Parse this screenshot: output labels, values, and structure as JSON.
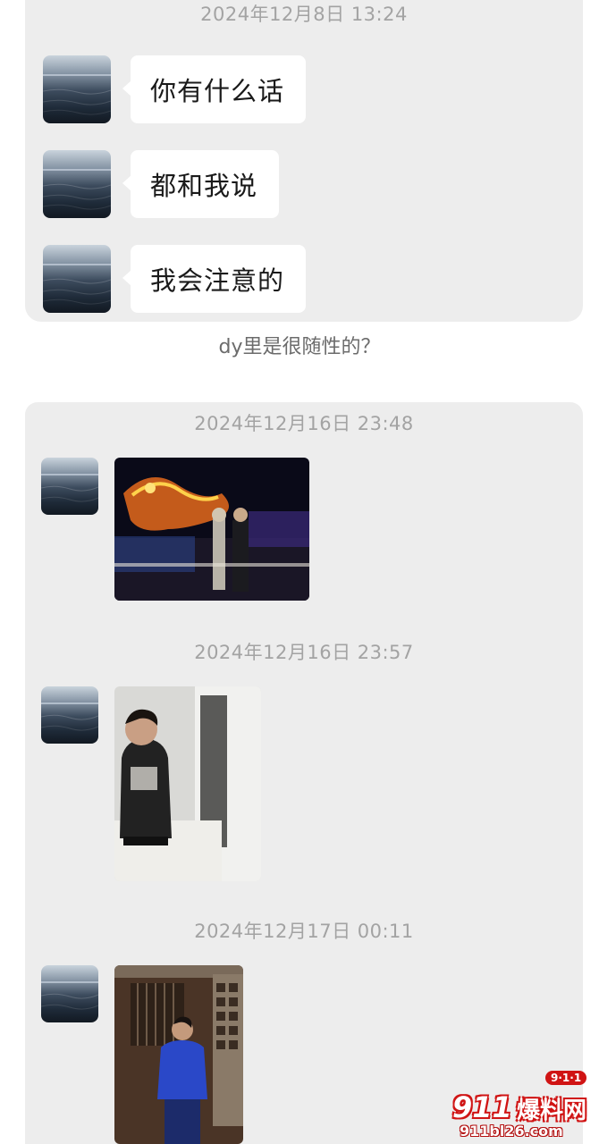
{
  "thread_top": {
    "timestamp": "2024年12月8日 13:24",
    "messages": [
      {
        "text": "你有什么话"
      },
      {
        "text": "都和我说"
      },
      {
        "text": "我会注意的"
      }
    ]
  },
  "caption": "dy里是很随性的？",
  "thread_bottom": {
    "groups": [
      {
        "timestamp": "2024年12月16日 23:48",
        "image": "night-dragon-lantern-photo"
      },
      {
        "timestamp": "2024年12月16日 23:57",
        "image": "mirror-selfie-photo"
      },
      {
        "timestamp": "2024年12月17日 00:11",
        "image": "blue-shirt-standing-photo"
      }
    ]
  },
  "watermark": {
    "number": "911",
    "name": "爆料网",
    "url": "911bl26.com",
    "badge": "9·1·1"
  },
  "colors": {
    "panel_bg": "#ededed",
    "bubble_bg": "#ffffff",
    "timestamp": "#a3a3a3",
    "watermark_red": "#d01414"
  }
}
